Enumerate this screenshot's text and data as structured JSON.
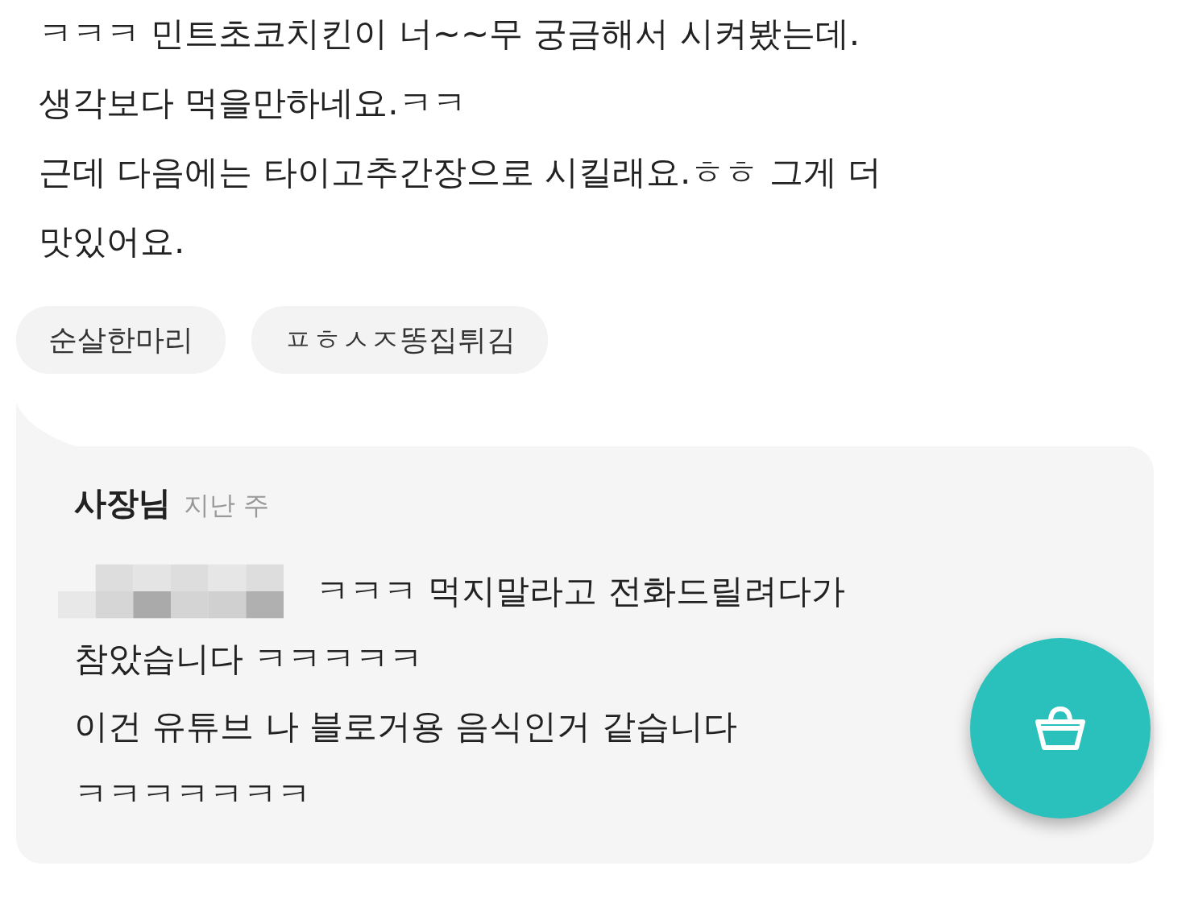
{
  "review": {
    "lines": [
      "ㅋㅋㅋ 민트초코치킨이 너~~무 궁금해서 시켜봤는데.",
      "생각보다 먹을만하네요.ㅋㅋ",
      "근데 다음에는 타이고추간장으로 시킬래요.ㅎㅎ 그게 더",
      "맛있어요."
    ]
  },
  "menu_tags": [
    "순살한마리",
    "ㅍㅎㅅㅈ똥집튀김"
  ],
  "owner_reply": {
    "author": "사장님",
    "time": "지난 주",
    "redacted_name": true,
    "lines": [
      "ㅋㅋㅋ 먹지말라고 전화드릴려다가",
      "참았습니다 ㅋㅋㅋㅋㅋ",
      "이건 유튜브 나 블로거용 음식인거 같습니다",
      "ㅋㅋㅋㅋㅋㅋㅋ"
    ]
  },
  "cart_button": {
    "kind": "basket"
  }
}
